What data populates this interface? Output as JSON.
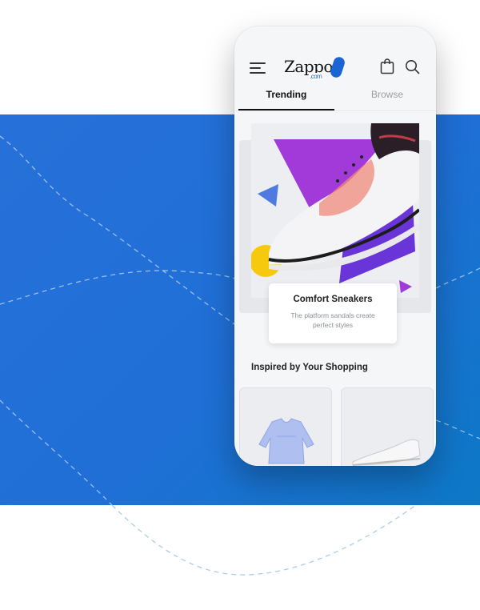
{
  "header": {
    "logo_text": "Zappos",
    "logo_suffix": ".com"
  },
  "tabs": [
    {
      "label": "Trending",
      "active": true
    },
    {
      "label": "Browse",
      "active": false
    }
  ],
  "featured": {
    "title": "Comfort Sneakers",
    "subtitle": "The platform sandals create perfect styles"
  },
  "section": {
    "title": "Inspired by Your Shopping"
  },
  "products": [
    {
      "icon": "blouse-icon"
    },
    {
      "icon": "sneaker-icon"
    }
  ],
  "colors": {
    "background_blue": "#2671d9",
    "brand_blue": "#1a64d4",
    "accent_purple": "#8a2be2",
    "accent_yellow": "#f6c90e"
  }
}
